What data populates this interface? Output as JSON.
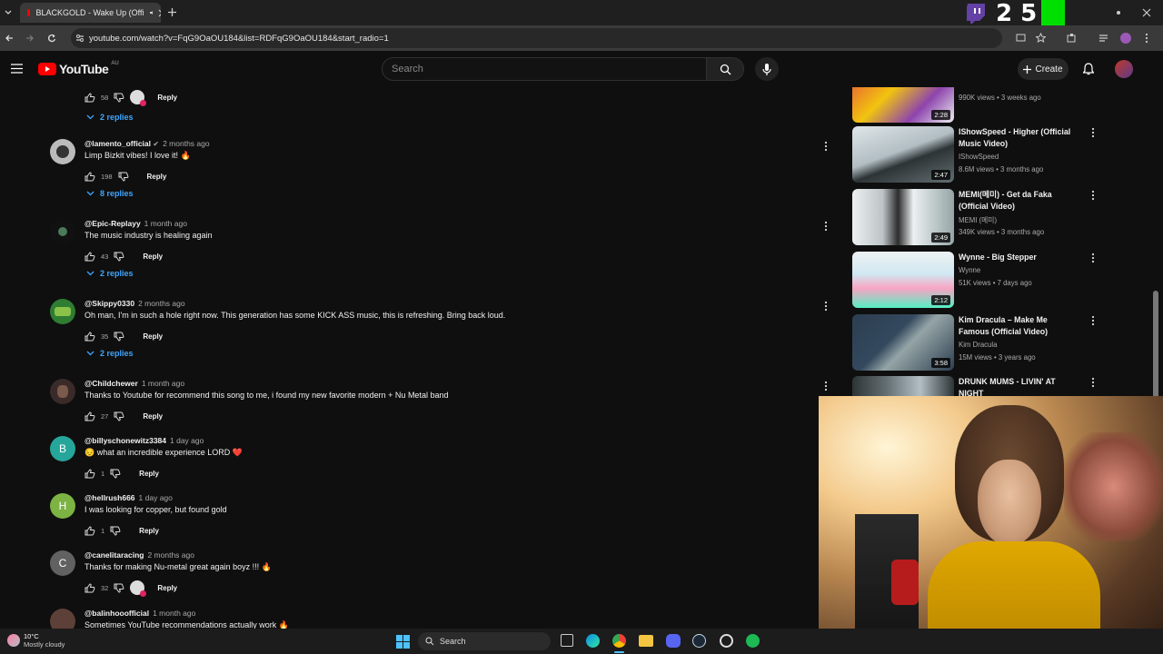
{
  "browser": {
    "tab_title": "BLACKGOLD - Wake Up (Offi",
    "url": "youtube.com/watch?v=FqG9OaOU184&list=RDFqG9OaOU184&start_radio=1"
  },
  "stream_overlay": {
    "numbers": "2  5"
  },
  "youtube": {
    "logo_text": "YouTube",
    "region": "AU",
    "search_placeholder": "Search",
    "create_label": "Create"
  },
  "top_actions": {
    "likes": "58",
    "reply": "Reply",
    "replies": "2 replies"
  },
  "comments": [
    {
      "handle": "@lamento_official",
      "time": "2 months ago",
      "text": "Limp Bizkit vibes! I love it! 🔥",
      "likes": "198",
      "reply": "Reply",
      "replies": "8 replies",
      "avatar_letter": ""
    },
    {
      "handle": "@Epic-Replayy",
      "time": "1 month ago",
      "text": "The music industry is healing again",
      "likes": "43",
      "reply": "Reply",
      "replies": "2 replies",
      "avatar_letter": ""
    },
    {
      "handle": "@Skippy0330",
      "time": "2 months ago",
      "text": "Oh man, I'm in such a hole right now. This generation has some KICK ASS music, this is refreshing. Bring back loud.",
      "likes": "35",
      "reply": "Reply",
      "replies": "2 replies",
      "avatar_letter": ""
    },
    {
      "handle": "@Childchewer",
      "time": "1 month ago",
      "text": "Thanks to Youtube for recommend this song to me, i found my new favorite modern + Nu Metal band",
      "likes": "27",
      "reply": "Reply",
      "replies": "",
      "avatar_letter": ""
    },
    {
      "handle": "@billyschonewitz3384",
      "time": "1 day ago",
      "text": "😔 what an incredible experience LORD ❤️",
      "likes": "1",
      "reply": "Reply",
      "replies": "",
      "avatar_letter": "B"
    },
    {
      "handle": "@hellrush666",
      "time": "1 day ago",
      "text": "I was looking for copper, but found gold",
      "likes": "1",
      "reply": "Reply",
      "replies": "",
      "avatar_letter": "H"
    },
    {
      "handle": "@canelitaracing",
      "time": "2 months ago",
      "text": "Thanks for making Nu-metal great again boyz !!! 🔥",
      "likes": "32",
      "reply": "Reply",
      "replies": "",
      "avatar_letter": "C"
    },
    {
      "handle": "@balinhooofficial",
      "time": "1 month ago",
      "text": "Sometimes YouTube recommendations actually work 🔥",
      "likes": "",
      "reply": "",
      "replies": "",
      "avatar_letter": ""
    }
  ],
  "sidebar": [
    {
      "title": "",
      "channel": "",
      "stats": "990K views • 3 weeks ago",
      "duration": "2:28"
    },
    {
      "title": "IShowSpeed - Higher (Official Music Video)",
      "channel": "IShowSpeed",
      "stats": "8.6M views • 3 months ago",
      "duration": "2:47"
    },
    {
      "title": "MEMI(메미) - Get da Faka (Official Video)",
      "channel": "MEMI (메미)",
      "stats": "349K views • 3 months ago",
      "duration": "2:49"
    },
    {
      "title": "Wynne - Big Stepper",
      "channel": "Wynne",
      "stats": "51K views • 7 days ago",
      "duration": "2:12"
    },
    {
      "title": "Kim Dracula – Make Me Famous (Official Video)",
      "channel": "Kim Dracula",
      "stats": "15M views • 3 years ago",
      "duration": "3:58"
    },
    {
      "title": "DRUNK MUMS - LIVIN' AT NIGHT",
      "channel": "",
      "stats": "",
      "duration": ""
    }
  ],
  "taskbar": {
    "weather_temp": "10°C",
    "weather_desc": "Mostly cloudy",
    "search_label": "Search"
  },
  "colors": {
    "accent_link": "#3ea6ff",
    "yt_red": "#ff0000",
    "bg": "#0f0f0f"
  }
}
